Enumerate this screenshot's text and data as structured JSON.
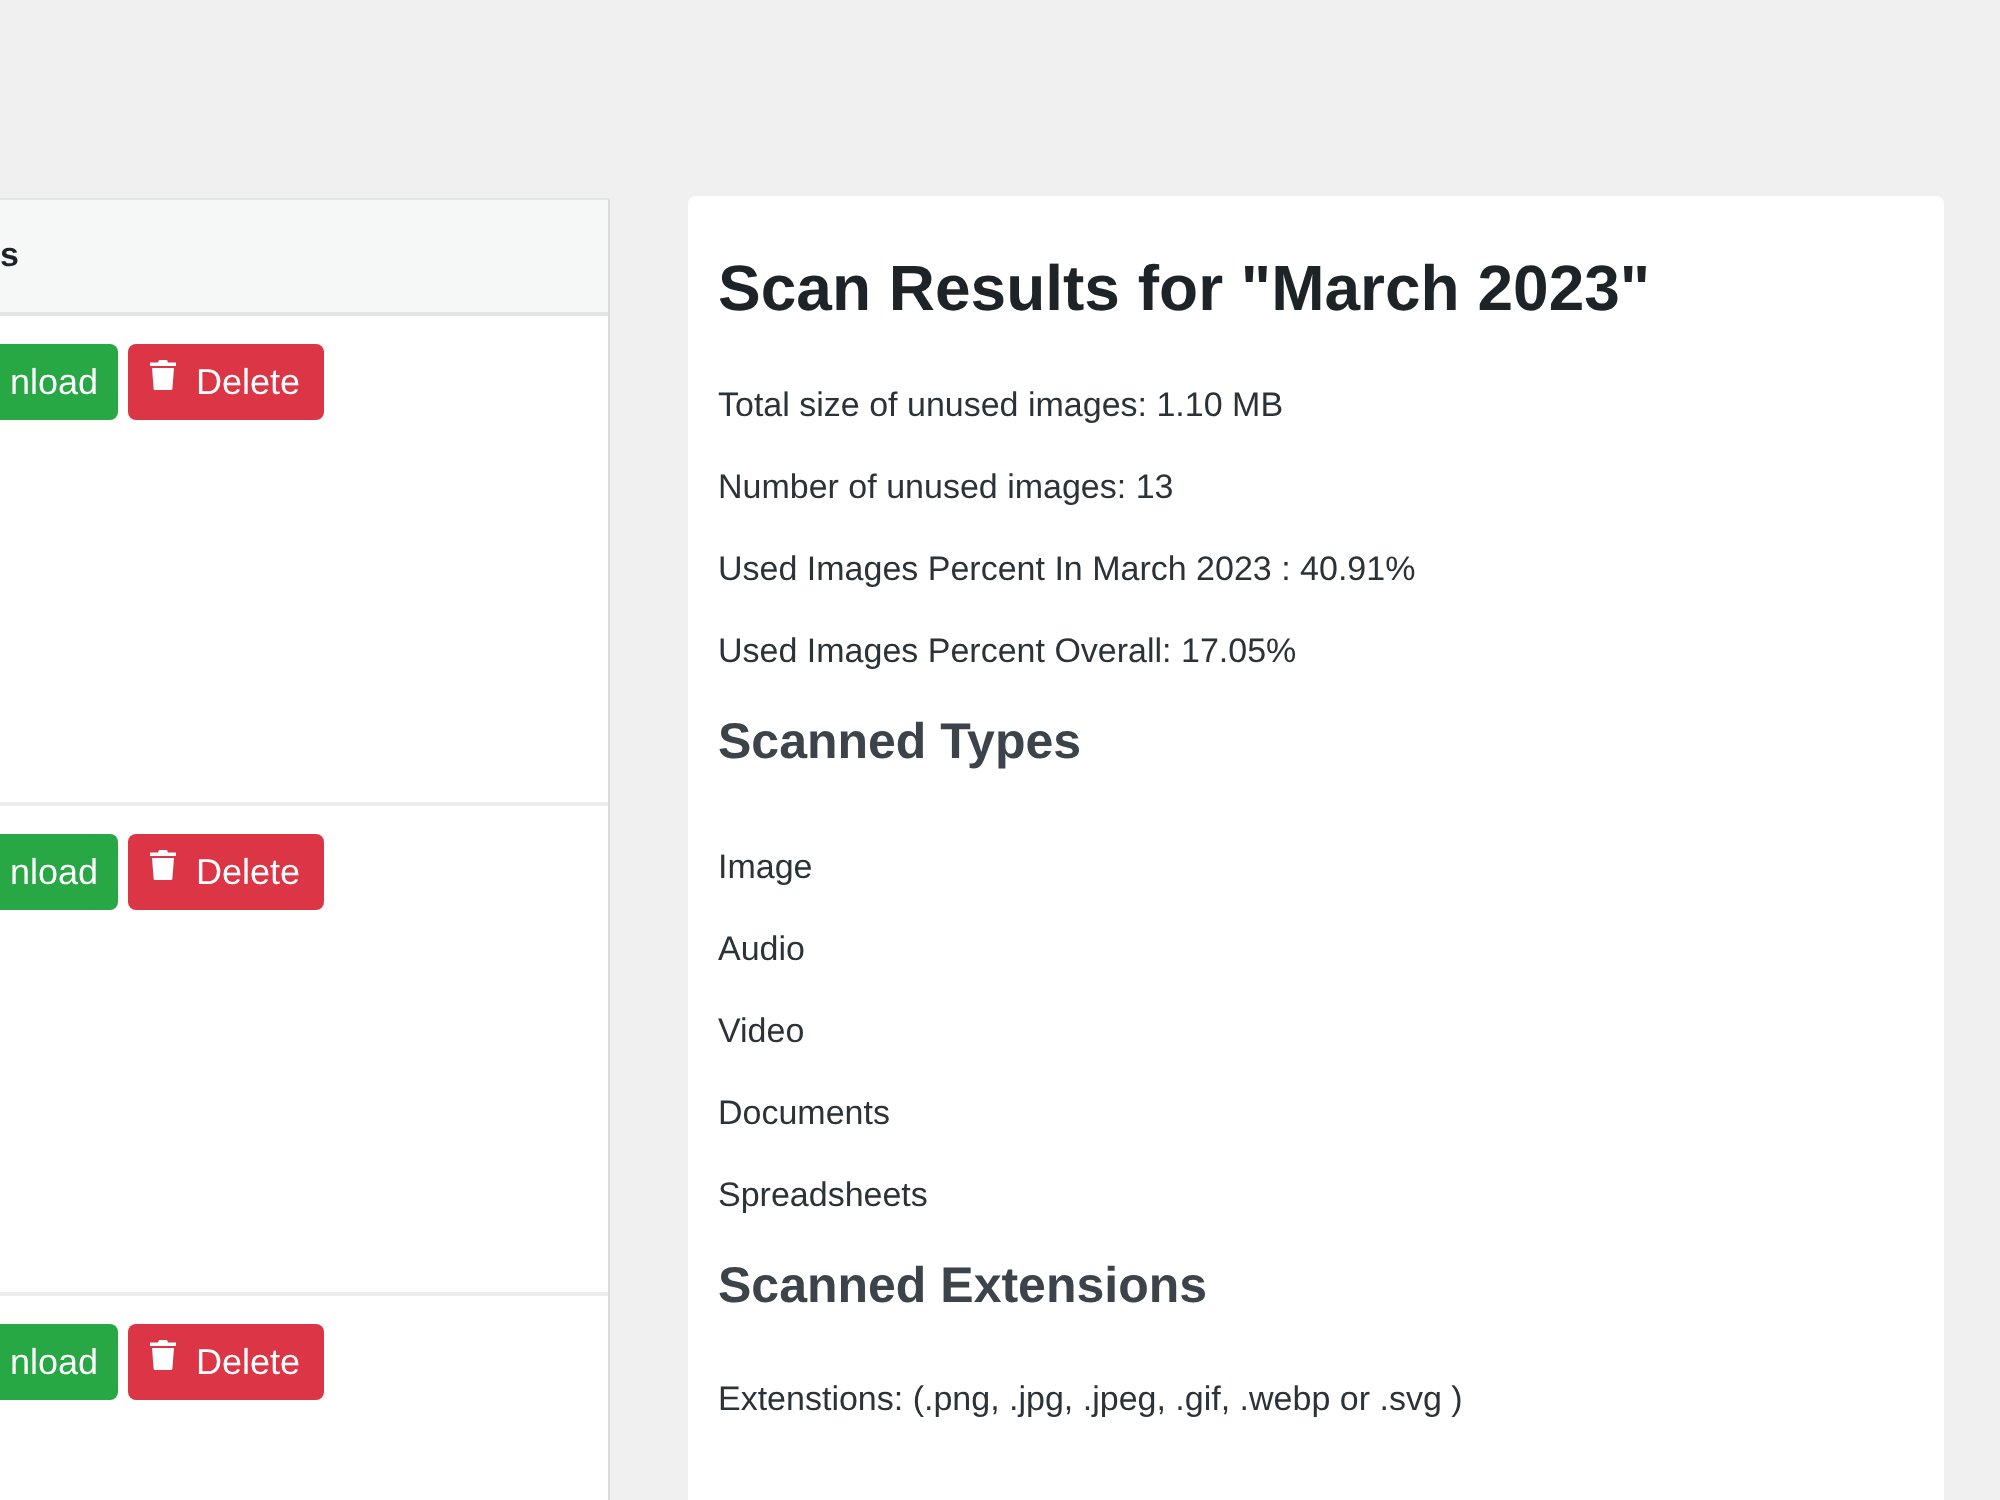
{
  "table": {
    "columns": [
      "s"
    ],
    "rows": [
      {
        "download_label": "nload",
        "delete_label": "Delete"
      },
      {
        "download_label": "nload",
        "delete_label": "Delete"
      },
      {
        "download_label": "nload",
        "delete_label": "Delete"
      }
    ]
  },
  "results": {
    "title": "Scan Results for \"March 2023\"",
    "stats": [
      "Total size of unused images: 1.10 MB",
      "Number of unused images: 13",
      "Used Images Percent In March 2023 : 40.91%",
      "Used Images Percent Overall: 17.05%"
    ],
    "types_heading": "Scanned Types",
    "types": [
      "Image",
      "Audio",
      "Video",
      "Documents",
      "Spreadsheets"
    ],
    "extensions_heading": "Scanned Extensions",
    "extensions": "Extenstions: (.png, .jpg, .jpeg, .gif, .webp or .svg )"
  }
}
